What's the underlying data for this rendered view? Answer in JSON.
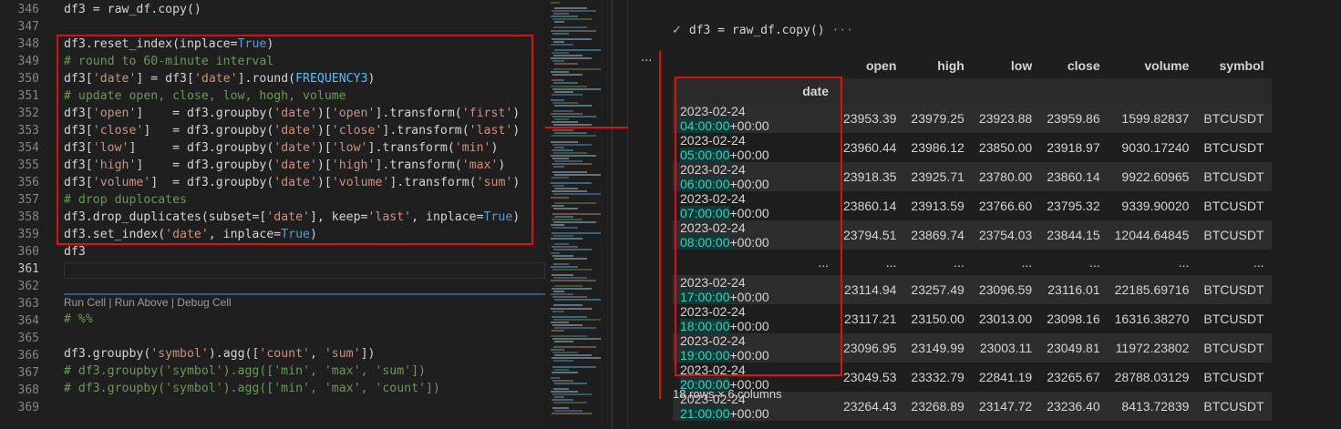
{
  "editor": {
    "line_numbers": [
      "346",
      "347",
      "348",
      "349",
      "350",
      "351",
      "352",
      "353",
      "354",
      "355",
      "356",
      "357",
      "358",
      "359",
      "360",
      "361",
      "362",
      "363",
      "364",
      "365",
      "366",
      "367",
      "368",
      "369"
    ],
    "run_cell_label": "Run Cell | Run Above | Debug Cell"
  },
  "output": {
    "cell_code": "df3 = raw_df.copy()",
    "cell_more": "···",
    "more_icon_text": "···",
    "columns": [
      "open",
      "high",
      "low",
      "close",
      "volume",
      "symbol"
    ],
    "index_name": "date",
    "rows": [
      {
        "date": "2023-02-24",
        "time": "04:00:00",
        "tz": "+00:00",
        "open": "23953.39",
        "high": "23979.25",
        "low": "23923.88",
        "close": "23959.86",
        "volume": "1599.82837",
        "symbol": "BTCUSDT"
      },
      {
        "date": "2023-02-24",
        "time": "05:00:00",
        "tz": "+00:00",
        "open": "23960.44",
        "high": "23986.12",
        "low": "23850.00",
        "close": "23918.97",
        "volume": "9030.17240",
        "symbol": "BTCUSDT"
      },
      {
        "date": "2023-02-24",
        "time": "06:00:00",
        "tz": "+00:00",
        "open": "23918.35",
        "high": "23925.71",
        "low": "23780.00",
        "close": "23860.14",
        "volume": "9922.60965",
        "symbol": "BTCUSDT"
      },
      {
        "date": "2023-02-24",
        "time": "07:00:00",
        "tz": "+00:00",
        "open": "23860.14",
        "high": "23913.59",
        "low": "23766.60",
        "close": "23795.32",
        "volume": "9339.90020",
        "symbol": "BTCUSDT"
      },
      {
        "date": "2023-02-24",
        "time": "08:00:00",
        "tz": "+00:00",
        "open": "23794.51",
        "high": "23869.74",
        "low": "23754.03",
        "close": "23844.15",
        "volume": "12044.64845",
        "symbol": "BTCUSDT"
      },
      {
        "ellipsis": "..."
      },
      {
        "date": "2023-02-24",
        "time": "17:00:00",
        "tz": "+00:00",
        "open": "23114.94",
        "high": "23257.49",
        "low": "23096.59",
        "close": "23116.01",
        "volume": "22185.69716",
        "symbol": "BTCUSDT"
      },
      {
        "date": "2023-02-24",
        "time": "18:00:00",
        "tz": "+00:00",
        "open": "23117.21",
        "high": "23150.00",
        "low": "23013.00",
        "close": "23098.16",
        "volume": "16316.38270",
        "symbol": "BTCUSDT"
      },
      {
        "date": "2023-02-24",
        "time": "19:00:00",
        "tz": "+00:00",
        "open": "23096.95",
        "high": "23149.99",
        "low": "23003.11",
        "close": "23049.81",
        "volume": "11972.23802",
        "symbol": "BTCUSDT"
      },
      {
        "date": "2023-02-24",
        "time": "20:00:00",
        "tz": "+00:00",
        "open": "23049.53",
        "high": "23332.79",
        "low": "22841.19",
        "close": "23265.67",
        "volume": "28788.03129",
        "symbol": "BTCUSDT"
      },
      {
        "date": "2023-02-24",
        "time": "21:00:00",
        "tz": "+00:00",
        "open": "23264.43",
        "high": "23268.89",
        "low": "23147.72",
        "close": "23236.40",
        "volume": "8413.72839",
        "symbol": "BTCUSDT"
      }
    ],
    "rows_info": "18 rows × 6 columns"
  },
  "colors": {
    "highlight_red": "#dd1111",
    "accent_blue": "#569cd6",
    "string": "#ce9178",
    "comment": "#6a9955"
  }
}
